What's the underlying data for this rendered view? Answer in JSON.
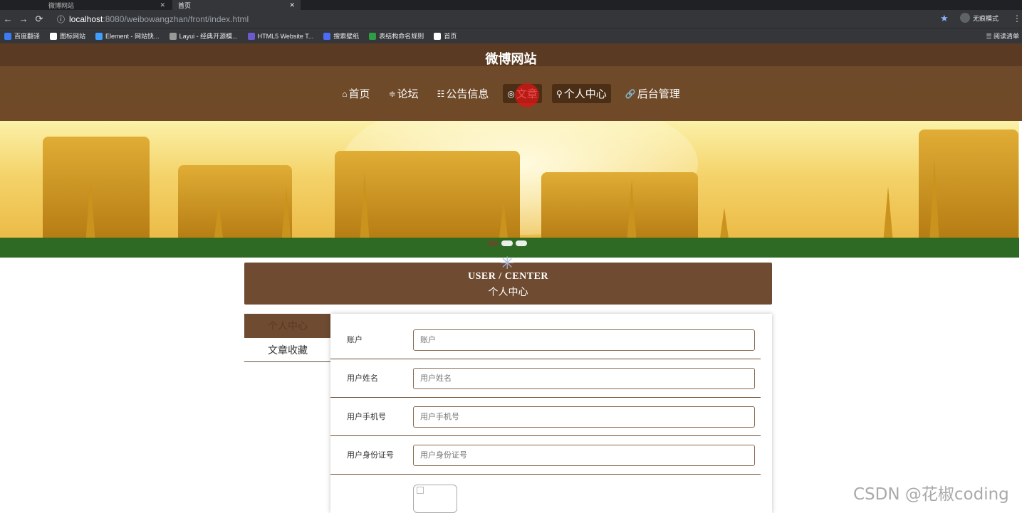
{
  "browser": {
    "tabs": [
      {
        "label": "微博网站"
      },
      {
        "label": "首页"
      }
    ],
    "url_host": "localhost",
    "url_rest": ":8080/weibowangzhan/front/index.html",
    "incognito_label": "无痕模式",
    "bookmarks": [
      {
        "label": "百度翻译",
        "color": "#3b7bf5"
      },
      {
        "label": "图标网站",
        "color": "#ffffff"
      },
      {
        "label": "Element - 网站快...",
        "color": "#409eff"
      },
      {
        "label": "Layui - 经典开源模...",
        "color": "#999999"
      },
      {
        "label": "HTML5 Website T...",
        "color": "#6a5acd"
      },
      {
        "label": "搜索壁纸",
        "color": "#4a6cf7"
      },
      {
        "label": "表结构命名规则",
        "color": "#2e9e44"
      },
      {
        "label": "首页",
        "color": "#ffffff"
      }
    ],
    "reading_list": "阅读清单"
  },
  "site": {
    "title": "微博网站",
    "nav": [
      {
        "icon": "⌂",
        "label": "首页",
        "active": false
      },
      {
        "icon": "≑",
        "label": "论坛",
        "active": false
      },
      {
        "icon": "☷",
        "label": "公告信息",
        "active": false
      },
      {
        "icon": "◎",
        "label": "文章",
        "active": true
      },
      {
        "icon": "⚲",
        "label": "个人中心",
        "active": true
      },
      {
        "icon": "🔗",
        "label": "后台管理",
        "active": false
      }
    ]
  },
  "user_center": {
    "title_en": "USER / CENTER",
    "title_zh": "个人中心",
    "side_menu": [
      {
        "label": "个人中心"
      },
      {
        "label": "文章收藏"
      }
    ],
    "fields": [
      {
        "label": "账户",
        "placeholder": "账户"
      },
      {
        "label": "用户姓名",
        "placeholder": "用户姓名"
      },
      {
        "label": "用户手机号",
        "placeholder": "用户手机号"
      },
      {
        "label": "用户身份证号",
        "placeholder": "用户身份证号"
      }
    ]
  },
  "watermark": "CSDN @花椒coding"
}
